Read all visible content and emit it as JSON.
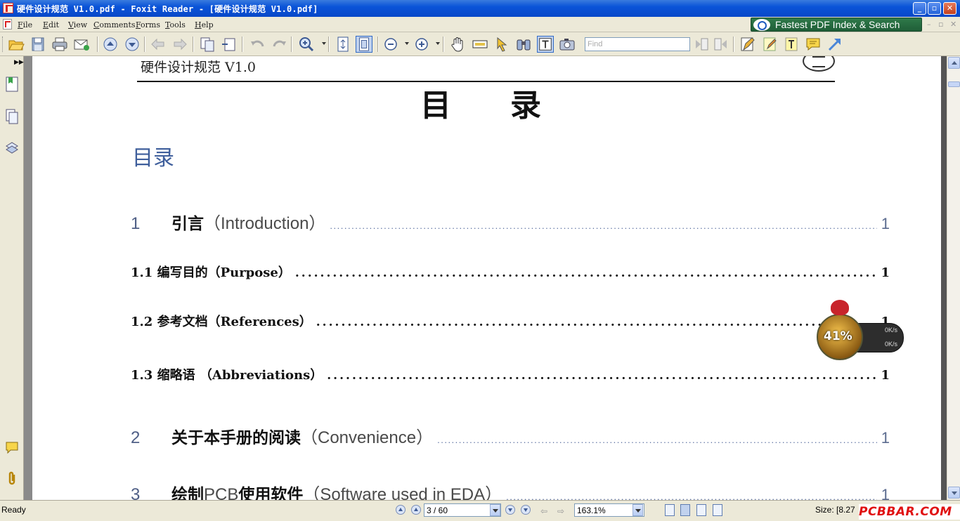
{
  "window": {
    "title": "硬件设计规范 V1.0.pdf - Foxit Reader - [硬件设计规范 V1.0.pdf]",
    "minimize": "_",
    "restore": "▫",
    "close": "✕"
  },
  "menu": {
    "items": [
      "File",
      "Edit",
      "View",
      "Comments",
      "Forms",
      "Tools",
      "Help"
    ]
  },
  "promo": {
    "label": "Fastest PDF Index & Search"
  },
  "toolbar": {
    "find_placeholder": "Find",
    "icons": [
      "open-icon",
      "save-icon",
      "print-icon",
      "email-icon",
      "first-page-icon",
      "next-page-icon",
      "back-icon",
      "forward-icon",
      "zoom-in-tool-icon",
      "actual-size-icon",
      "fit-page-icon",
      "zoom-out-icon",
      "zoom-in-icon",
      "hand-tool-icon",
      "select-text-icon",
      "select-annotation-icon",
      "binoculars-icon",
      "text-viewer-icon",
      "snapshot-icon",
      "search-prev-icon",
      "search-next-icon",
      "pencil-icon",
      "note-icon",
      "typewriter-icon",
      "comment-icon",
      "arrow-icon"
    ]
  },
  "document": {
    "header": "硬件设计规范 V1.0",
    "big_title": "目录",
    "toc_heading": "目录",
    "toc": [
      {
        "level": 1,
        "num": "1",
        "zh": "引言",
        "en": "（Introduction）",
        "page": "1"
      },
      {
        "level": 2,
        "text": "1.1 编写目的（Purpose）",
        "page": "1"
      },
      {
        "level": 2,
        "text": "1.2 参考文档（References）",
        "page": "1"
      },
      {
        "level": 2,
        "text": "1.3 缩略语 （Abbreviations）",
        "page": "1"
      },
      {
        "level": 1,
        "num": "2",
        "zh": "关于本手册的阅读",
        "en": "（Convenience）",
        "page": "1"
      },
      {
        "level": 1,
        "num": "3",
        "zh": "绘制 ",
        "en_mid": "PCB",
        "zh2": " 使用软件",
        "en": "（Software used in EDA）",
        "page": "1"
      }
    ]
  },
  "speed_widget": {
    "percent": "41%",
    "upload": "0K/s",
    "download": "0K/s"
  },
  "status": {
    "text": "Ready",
    "page_field": "3 / 60",
    "zoom": "163.1%",
    "size": "Size: [8.27",
    "watermark": "PCBBAR.COM"
  }
}
